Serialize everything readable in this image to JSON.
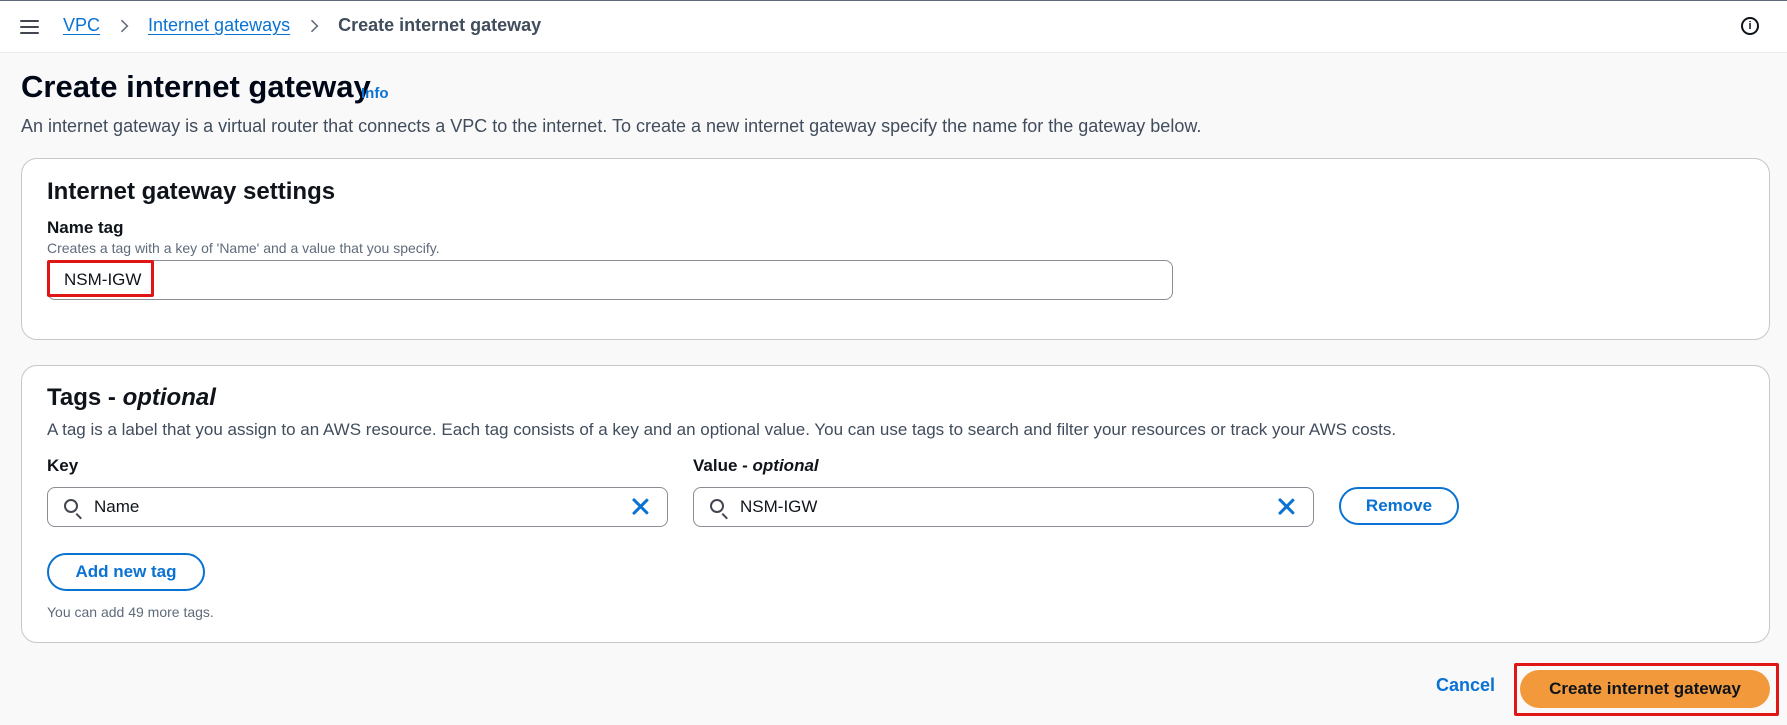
{
  "breadcrumb": {
    "items": [
      "VPC",
      "Internet gateways"
    ],
    "current": "Create internet gateway"
  },
  "page": {
    "title": "Create internet gateway",
    "info_link": "Info",
    "description": "An internet gateway is a virtual router that connects a VPC to the internet. To create a new internet gateway specify the name for the gateway below."
  },
  "settings": {
    "heading": "Internet gateway settings",
    "name_tag_label": "Name tag",
    "name_tag_description": "Creates a tag with a key of 'Name' and a value that you specify.",
    "name_tag_value": "NSM-IGW"
  },
  "tags": {
    "heading": "Tags - ",
    "heading_optional": "optional",
    "description": "A tag is a label that you assign to an AWS resource. Each tag consists of a key and an optional value. You can use tags to search and filter your resources or track your AWS costs.",
    "key_label": "Key",
    "value_label": "Value - ",
    "value_label_optional": "optional",
    "rows": [
      {
        "key": "Name",
        "value": "NSM-IGW"
      }
    ],
    "remove_label": "Remove",
    "add_label": "Add new tag",
    "remaining_text": "You can add 49 more tags."
  },
  "footer": {
    "cancel_label": "Cancel",
    "create_label": "Create internet gateway"
  },
  "colors": {
    "link": "#0972d3",
    "primary_button": "#f2993c",
    "highlight": "#e01515"
  }
}
